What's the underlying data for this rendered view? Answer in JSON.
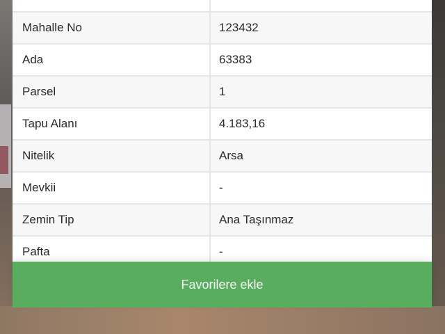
{
  "parcel_details": {
    "rows": [
      {
        "label": "",
        "value": ""
      },
      {
        "label": "Mahalle No",
        "value": "123432"
      },
      {
        "label": "Ada",
        "value": "63383"
      },
      {
        "label": "Parsel",
        "value": "1"
      },
      {
        "label": "Tapu Alanı",
        "value": "4.183,16"
      },
      {
        "label": "Nitelik",
        "value": "Arsa"
      },
      {
        "label": "Mevkii",
        "value": "-"
      },
      {
        "label": "Zemin Tip",
        "value": "Ana Taşınmaz"
      },
      {
        "label": "Pafta",
        "value": "-"
      }
    ]
  },
  "actions": {
    "add_favorites_label": "Favorilere ekle",
    "button_color": "#58ae5e"
  }
}
